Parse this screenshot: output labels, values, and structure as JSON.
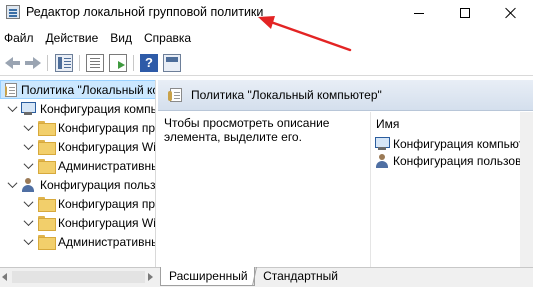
{
  "window": {
    "title": "Редактор локальной групповой политики",
    "controls": [
      "minimize",
      "maximize",
      "close"
    ]
  },
  "menu": [
    "Файл",
    "Действие",
    "Вид",
    "Справка"
  ],
  "toolbar": {
    "icons": [
      "back-icon",
      "forward-icon",
      "show-console-tree-icon",
      "properties-icon",
      "export-list-icon",
      "help-icon",
      "view-icon"
    ],
    "help_label": "?"
  },
  "tree": {
    "root": "Политика \"Локальный компьютер\"",
    "items": [
      {
        "label": "Конфигурация компьютера",
        "level": 1,
        "icon": "computer-icon"
      },
      {
        "label": "Конфигурация программ",
        "level": 2,
        "icon": "folder-icon"
      },
      {
        "label": "Конфигурация Windows",
        "level": 2,
        "icon": "folder-icon"
      },
      {
        "label": "Административные шаблоны",
        "level": 2,
        "icon": "folder-icon"
      },
      {
        "label": "Конфигурация пользователя",
        "level": 1,
        "icon": "user-icon"
      },
      {
        "label": "Конфигурация программ",
        "level": 2,
        "icon": "folder-icon"
      },
      {
        "label": "Конфигурация Windows",
        "level": 2,
        "icon": "folder-icon"
      },
      {
        "label": "Административные шаблоны",
        "level": 2,
        "icon": "folder-icon"
      }
    ]
  },
  "details": {
    "header": "Политика \"Локальный компьютер\"",
    "description": "Чтобы просмотреть описание элемента, выделите его.",
    "column": "Имя",
    "items": [
      {
        "label": "Конфигурация компьютера",
        "icon": "computer-icon"
      },
      {
        "label": "Конфигурация пользователя",
        "icon": "user-icon"
      }
    ]
  },
  "tabs": [
    "Расширенный",
    "Стандартный"
  ],
  "colors": {
    "selection": "#cce8ff",
    "annotation_arrow": "#e32424"
  }
}
